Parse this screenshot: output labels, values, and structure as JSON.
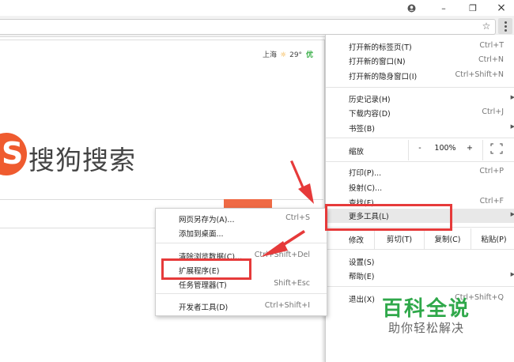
{
  "window": {
    "account_icon": "account-icon",
    "minimize": "–",
    "restore": "❐",
    "close": "×"
  },
  "toolbar": {
    "star_icon": "☆"
  },
  "page": {
    "weather_city": "上海",
    "weather_temp": "29°",
    "weather_air": "优",
    "logo_glyph": "S",
    "logo_text": "搜狗搜索"
  },
  "main_menu": {
    "new_tab": "打开新的标签页(T)",
    "new_tab_sc": "Ctrl+T",
    "new_window": "打开新的窗口(N)",
    "new_window_sc": "Ctrl+N",
    "incognito": "打开新的隐身窗口(I)",
    "incognito_sc": "Ctrl+Shift+N",
    "history": "历史记录(H)",
    "downloads": "下载内容(D)",
    "downloads_sc": "Ctrl+J",
    "bookmarks": "书签(B)",
    "zoom_label": "缩放",
    "zoom_minus": "-",
    "zoom_value": "100%",
    "zoom_plus": "+",
    "print": "打印(P)...",
    "print_sc": "Ctrl+P",
    "cast": "投射(C)...",
    "find": "查找(F)...",
    "find_sc": "Ctrl+F",
    "more_tools": "更多工具(L)",
    "edit_label": "修改",
    "cut": "剪切(T)",
    "copy": "复制(C)",
    "paste": "粘贴(P)",
    "settings": "设置(S)",
    "help": "帮助(E)",
    "exit": "退出(X)",
    "exit_sc": "Ctrl+Shift+Q"
  },
  "submenu": {
    "save_as": "网页另存为(A)...",
    "save_as_sc": "Ctrl+S",
    "add_desktop": "添加到桌面...",
    "clear_data": "清除浏览数据(C)...",
    "clear_data_sc": "Ctrl+Shift+Del",
    "extensions": "扩展程序(E)",
    "task_manager": "任务管理器(T)",
    "task_manager_sc": "Shift+Esc",
    "dev_tools": "开发者工具(D)",
    "dev_tools_sc": "Ctrl+Shift+I"
  },
  "watermark": {
    "title": "百科全说",
    "subtitle": "助你轻松解决"
  },
  "colors": {
    "annotation_red": "#e63a3a",
    "logo_orange": "#ef5b2f",
    "watermark_green": "#2fa84a"
  }
}
